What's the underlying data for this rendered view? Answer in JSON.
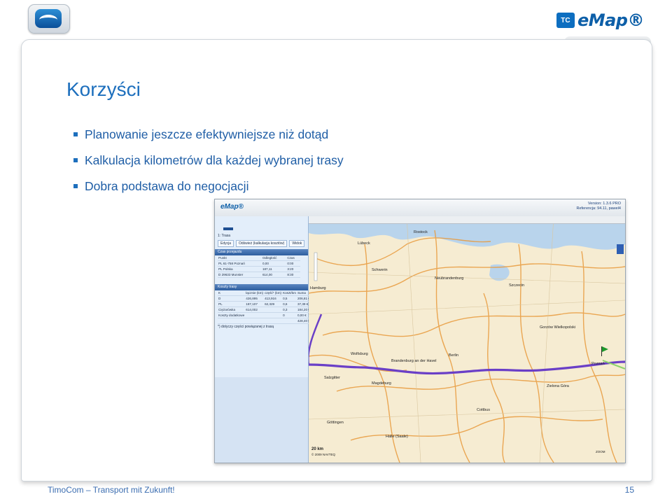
{
  "header": {
    "emap_logo_tc": "TC",
    "emap_logo_word": "eMap®"
  },
  "slide": {
    "title": "Korzyści",
    "bullets": [
      "Planowanie jeszcze efektywniejsze niż dotąd",
      "Kalkulacja kilometrów dla każdej wybranej trasy",
      "Dobra podstawa do negocjacji"
    ]
  },
  "screenshot": {
    "logo": "eMap®",
    "version_line1": "Version: 1.3.6 PRO",
    "version_line2": "Referencja: 94.11, pawel4",
    "route_header": "1: Trasa",
    "buttons": [
      "Edycja",
      "Odśwież (kalkulacja kosztów)",
      "Widok"
    ],
    "section_time": "Czas przejazdu",
    "time_headers": [
      "Punkt",
      "Odległość",
      "Czas"
    ],
    "time_rows": [
      [
        "PL",
        "61-758 Poznań",
        "0,00",
        "0:00"
      ],
      [
        "PL",
        "Polska",
        "187,11",
        "3:20"
      ],
      [
        "D",
        "29633 Munster",
        "614,00",
        "8:30"
      ]
    ],
    "section_costs": "Koszty trasy",
    "cost_headers": [
      "K",
      "łącznie (km)",
      "część* (km)",
      "Koszt/km",
      "Suma"
    ],
    "cost_rows": [
      [
        "D",
        "426,895",
        "413,916",
        "0,5",
        "206,81 €"
      ],
      [
        "PL",
        "187,107",
        "62,329",
        "0,6",
        "37,39 €"
      ]
    ],
    "extra_rows": [
      [
        "Ciężarówka",
        "614,002",
        "0,3",
        "184,20 €"
      ],
      [
        "Koszty dodatkowe",
        "",
        "0",
        "0,00 €"
      ],
      [
        "",
        "",
        "",
        "428,40 €"
      ]
    ],
    "note": "*) dotyczy części powiązanej z trasą",
    "map_cities": [
      "Rostock",
      "Lübeck",
      "Schwerin",
      "Neubrandenburg",
      "Szczecin",
      "Hamburg",
      "Wolfsburg",
      "Brandenburg an der Havel",
      "Berlin",
      "Gorzów Wielkopolski",
      "Poznań",
      "Zielona Góra",
      "Magdeburg",
      "Salzgitter",
      "Göttingen",
      "Halle (Saale)",
      "Cottbus"
    ],
    "map_copyright": "© 2009 NAVTEQ",
    "map_scale": "20 km",
    "map_zoom": "ZOOM",
    "route_color": "#6a3fc7",
    "road_color": "#e89a3c"
  },
  "footer": {
    "left": "TimoCom – Transport mit Zukunft!",
    "page": "15"
  }
}
